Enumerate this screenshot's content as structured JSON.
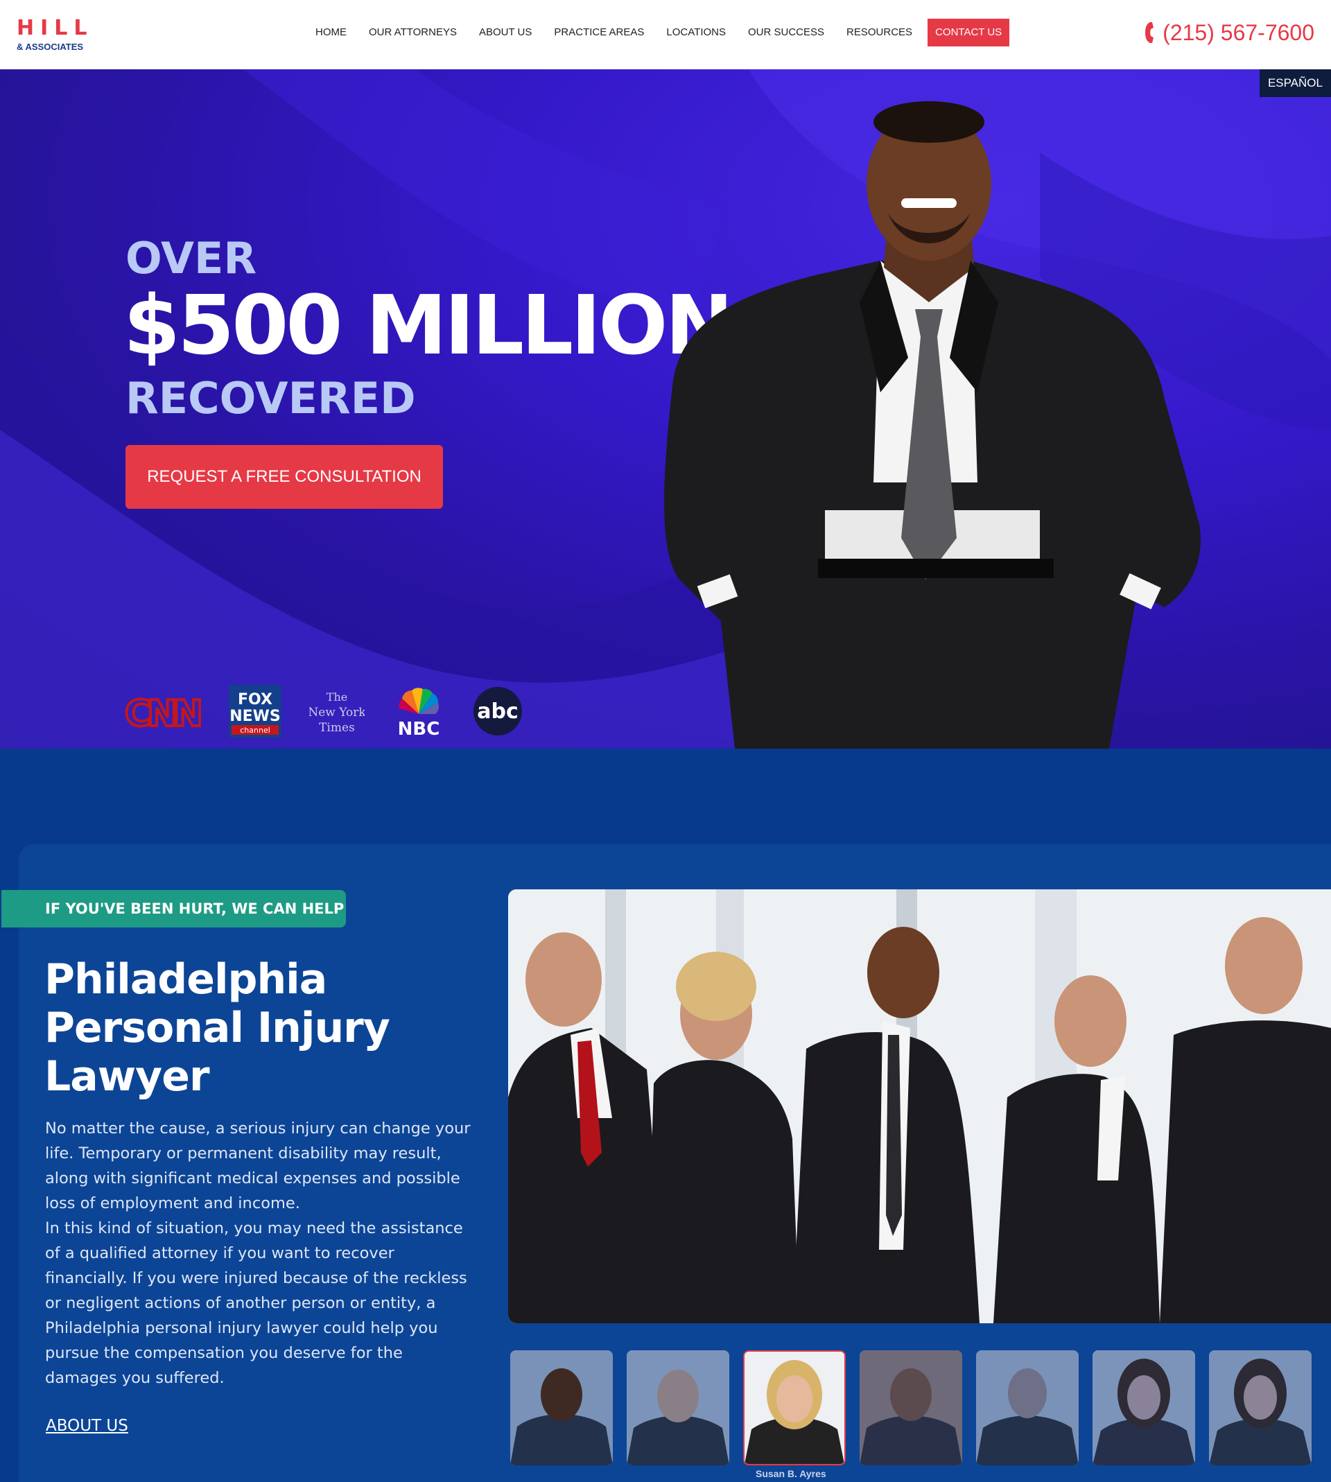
{
  "header": {
    "logo_main": "HILL",
    "logo_sub": "& ASSOCIATES",
    "nav": [
      "HOME",
      "OUR ATTORNEYS",
      "ABOUT US",
      "PRACTICE AREAS",
      "LOCATIONS",
      "OUR SUCCESS",
      "RESOURCES"
    ],
    "contact_label": "CONTACT US",
    "phone": "(215) 567-7600"
  },
  "hero": {
    "language_button": "ESPAÑOL",
    "line1": "OVER",
    "line2": "$500 MILLION",
    "line3": "RECOVERED",
    "cta": "REQUEST A FREE CONSULTATION",
    "media_logos": [
      "CNN",
      "FOX NEWS channel",
      "The New York Times",
      "NBC",
      "abc"
    ]
  },
  "intro": {
    "badge": "IF YOU'VE BEEN HURT, WE CAN HELP",
    "title": "Philadelphia Personal Injury Lawyer",
    "paragraph1": "No matter the cause, a serious injury can change your life. Temporary or permanent disability may result, along with significant medical expenses and possible loss of employment and income.",
    "paragraph2": "In this kind of situation, you may need the assistance of a qualified attorney if you want to recover financially. If you were injured because of the reckless or negligent actions of another person or entity, a Philadelphia personal injury lawyer could help you pursue the compensation you deserve for the damages you suffered.",
    "about_link": "ABOUT US",
    "selected_attorney": "Susan B. Ayres"
  },
  "colors": {
    "brand_red": "#e63946",
    "navy": "#073a8c",
    "teal": "#1e9b84",
    "hero_purple": "#3419c9"
  },
  "media_logos": {
    "cnn": "CNN",
    "fox_top": "FOX",
    "fox_mid": "NEWS",
    "fox_bottom": "channel",
    "nyt_1": "The",
    "nyt_2": "New York",
    "nyt_3": "Times",
    "nbc": "NBC",
    "abc": "abc"
  }
}
